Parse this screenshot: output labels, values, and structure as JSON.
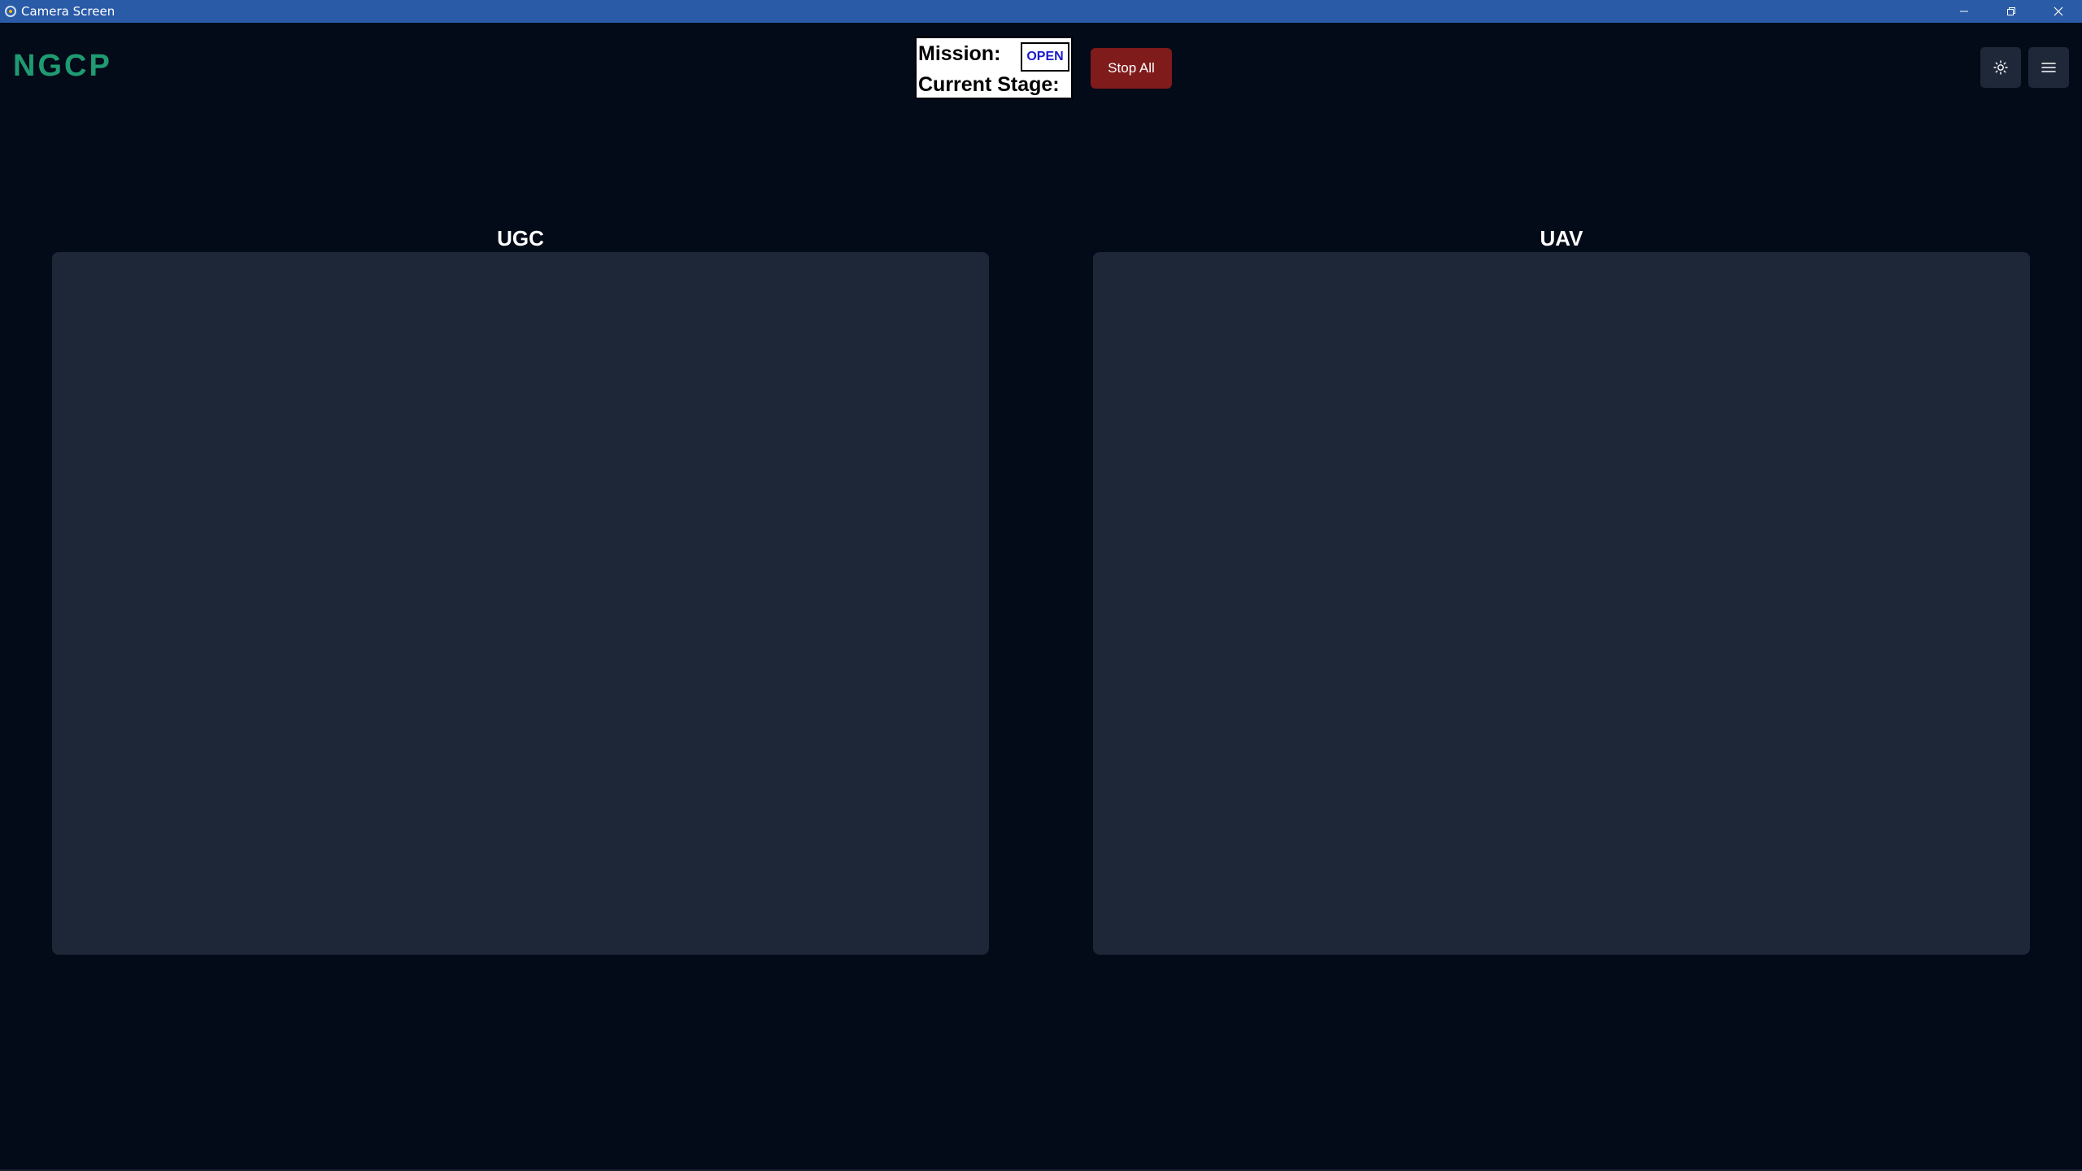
{
  "window": {
    "title": "Camera Screen"
  },
  "header": {
    "logo": "NGCP",
    "mission_label": "Mission:",
    "mission_status": "OPEN",
    "stage_label": "Current Stage:",
    "stop_all_label": "Stop All"
  },
  "icons": {
    "theme": "sun-icon",
    "menu": "hamburger-menu-icon",
    "app": "app-icon"
  },
  "panels": [
    {
      "label": "UGC"
    },
    {
      "label": "UAV"
    }
  ],
  "colors": {
    "background": "#030a18",
    "titlebar": "#2a5ba7",
    "logo": "#1f9b72",
    "stop_button": "#7f1b1b",
    "panel": "#1d2738",
    "mission_status_text": "#1a1acc"
  }
}
